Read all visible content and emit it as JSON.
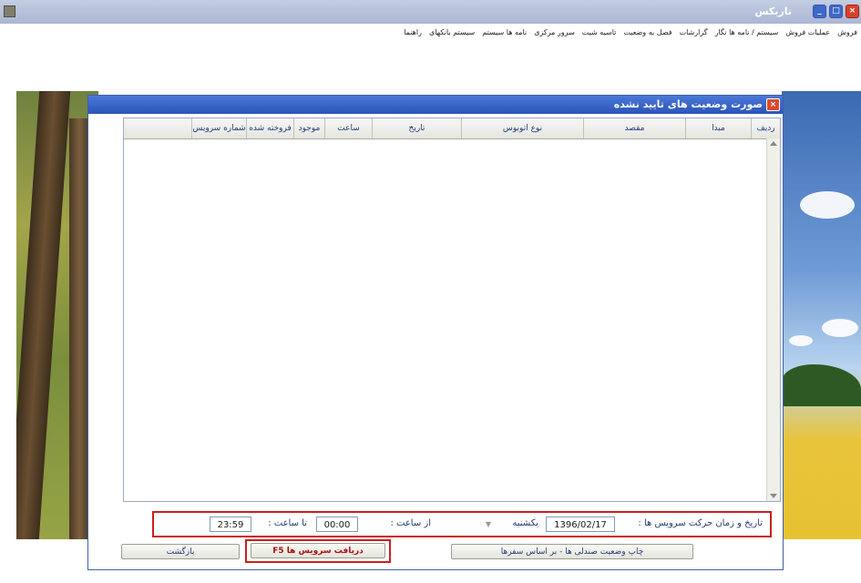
{
  "app": {
    "title": "تاربکس",
    "window_controls": [
      "_",
      "□",
      "×"
    ]
  },
  "menu": [
    "فروش",
    "عملیات فروش",
    "سیستم / نامه ها نگار",
    "گزارشات",
    "فصل به وضعیت",
    "تاسیه شیت",
    "سرور مرکزی",
    "نامه ها سیستم",
    "سیستم بانکهای",
    "راهنما"
  ],
  "dialog": {
    "title": "صورت وضعیت های تایید نشده",
    "close_icon": "×",
    "columns": [
      "ردیف",
      "مبدا",
      "مقصد",
      "نوع اتوبوس",
      "تاریخ",
      "ساعت",
      "موجود",
      "فروخته شده",
      "شماره سرویس"
    ],
    "filter": {
      "date_label": "تاریخ و زمان حرکت سرویس ها :",
      "date_value": "1396/02/17",
      "day_label": "یکشنبه",
      "from_time_label": "از ساعت :",
      "from_time_value": "00:00",
      "to_time_label": "تا ساعت :",
      "to_time_value": "23:59"
    },
    "buttons": {
      "print": "چاپ وضعیت صندلی ها - بر اساس سفرها",
      "receive": "دریافت سرویس ها F5",
      "back": "بازگشت"
    }
  }
}
